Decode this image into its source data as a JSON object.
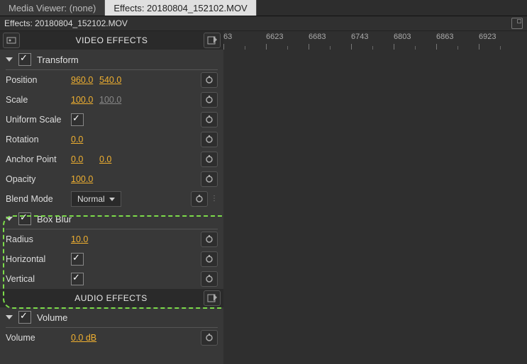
{
  "tabs": {
    "media_viewer": "Media Viewer: (none)",
    "effects": "Effects: 20180804_152102.MOV"
  },
  "sub_header": "Effects: 20180804_152102.MOV",
  "sections": {
    "video_title": "VIDEO EFFECTS",
    "audio_title": "AUDIO EFFECTS"
  },
  "transform": {
    "header": "Transform",
    "position": {
      "label": "Position",
      "x": "960.0",
      "y": "540.0"
    },
    "scale": {
      "label": "Scale",
      "x": "100.0",
      "y": "100.0"
    },
    "uniform_scale": {
      "label": "Uniform Scale"
    },
    "rotation": {
      "label": "Rotation",
      "value": "0.0"
    },
    "anchor": {
      "label": "Anchor Point",
      "x": "0.0",
      "y": "0.0"
    },
    "opacity": {
      "label": "Opacity",
      "value": "100.0"
    },
    "blend": {
      "label": "Blend Mode",
      "value": "Normal"
    }
  },
  "box_blur": {
    "header": "Box Blur",
    "radius": {
      "label": "Radius",
      "value": "10.0"
    },
    "horizontal": {
      "label": "Horizontal"
    },
    "vertical": {
      "label": "Vertical"
    }
  },
  "volume_section": {
    "header": "Volume",
    "volume": {
      "label": "Volume",
      "value": "0.0 dB"
    }
  },
  "ruler": [
    "63",
    "6623",
    "6683",
    "6743",
    "6803",
    "6863",
    "6923"
  ]
}
